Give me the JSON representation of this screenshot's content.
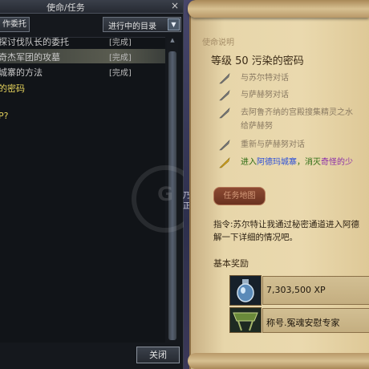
{
  "quest_window": {
    "title": "使命/任务",
    "close_icon": "×",
    "commission_button": "作委托",
    "filter": {
      "selected": "进行中的目录",
      "arrow": "▼"
    },
    "quests": [
      {
        "name": "探讨伐队长的委托",
        "status": "[完成]"
      },
      {
        "name": "奇杰军团的攻墓",
        "status": "[完成]"
      },
      {
        "name": "城寨的方法",
        "status": "[完成]"
      },
      {
        "name": "的密码",
        "status": ""
      },
      {
        "name": "P?",
        "status": ""
      }
    ],
    "close_button": "关闭"
  },
  "middle": {
    "text": "乃\n正"
  },
  "quest_detail": {
    "description_label": "使命说明",
    "title": "等级 50 污染的密码",
    "steps": [
      {
        "text": "与苏尔特对话",
        "done": true
      },
      {
        "text": "与萨赫努对话",
        "done": true
      },
      {
        "text": "去阿鲁齐纳的宫殿搜集精灵之水",
        "text_line2": "给萨赫努",
        "done": true
      },
      {
        "text": "重新与萨赫努对话",
        "done": true
      },
      {
        "prefix": "进入",
        "place": "阿德玛城寨",
        "middle": "，消灭",
        "target": "奇怪的少",
        "done": false
      }
    ],
    "quest_map_button": "任务地图",
    "instruction_line1": "指令:苏尔特让我通过秘密通道进入阿德",
    "instruction_line2": "解一下详细的情况吧。",
    "rewards_label": "基本奖励",
    "rewards": [
      {
        "icon": "potion-icon",
        "text": "7,303,500 XP"
      },
      {
        "icon": "title-badge-icon",
        "text": "称号.冤魂安慰专家"
      }
    ]
  },
  "colors": {
    "complete_step": "#8a7a62",
    "active_step": "#2a6a10",
    "place_highlight": "#2c4fd8",
    "target_highlight": "#8a2ca8",
    "quest_title_highlight": "#e6d35c"
  }
}
